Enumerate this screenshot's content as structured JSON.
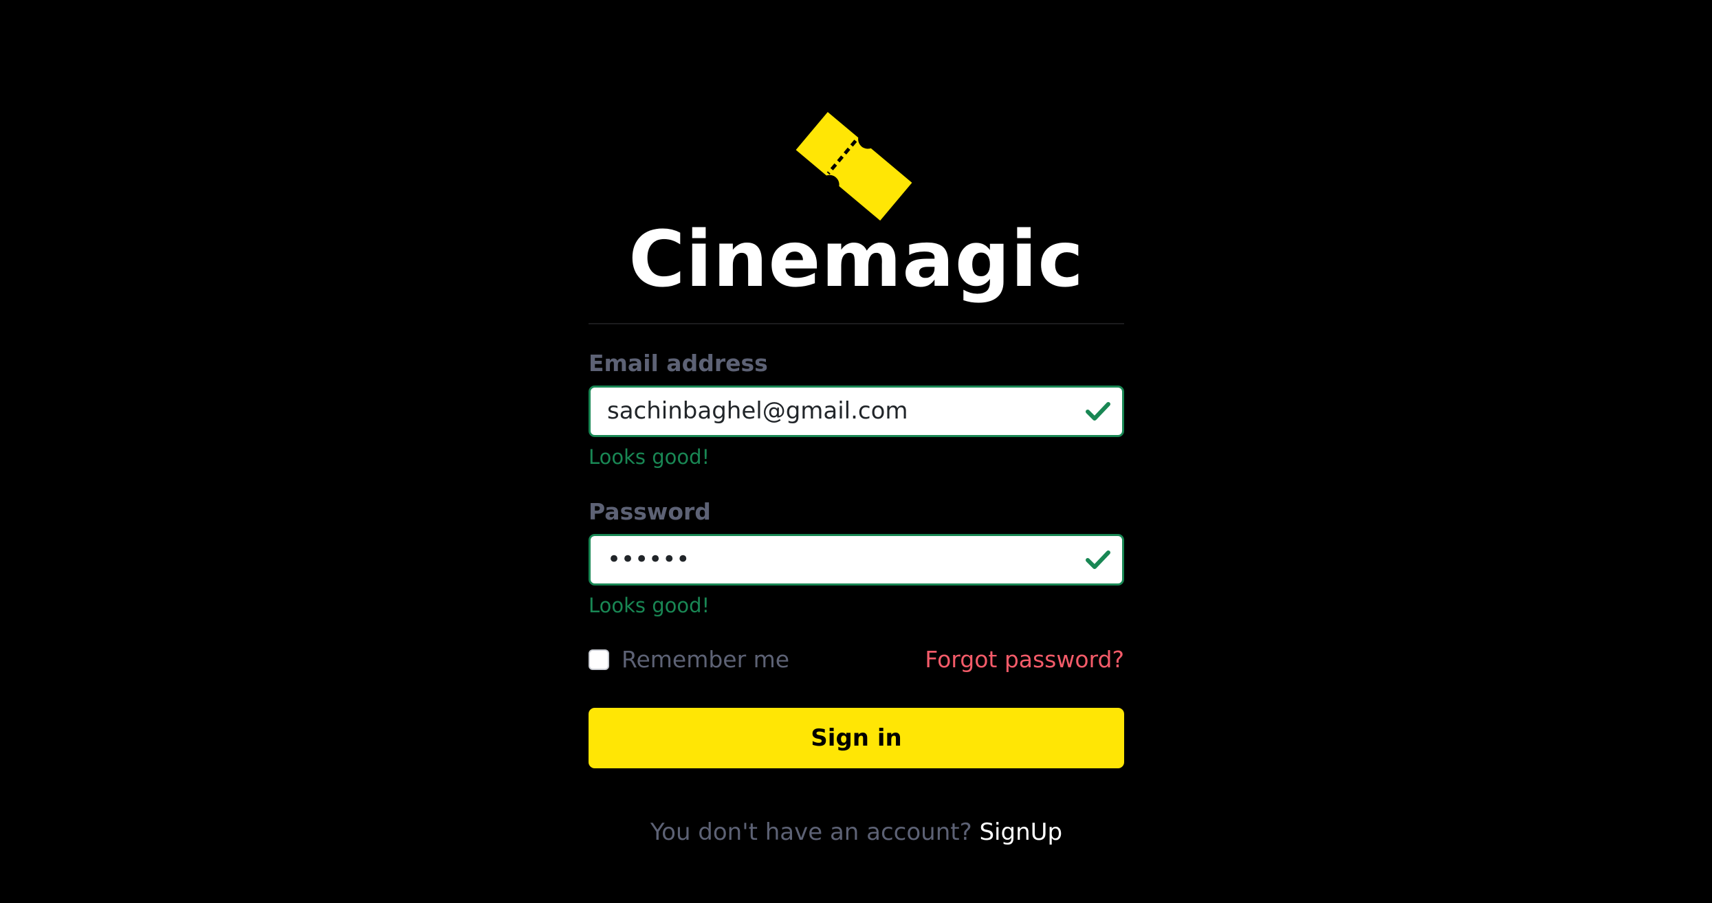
{
  "brand": {
    "logo_icon": "ticket-icon",
    "logo_color": "#ffe605",
    "title": "Cinemagic"
  },
  "form": {
    "email": {
      "label": "Email address",
      "value": "sachinbaghel@gmail.com",
      "feedback": "Looks good!",
      "state_icon": "check-icon"
    },
    "password": {
      "label": "Password",
      "value": "••••••",
      "feedback": "Looks good!",
      "state_icon": "check-icon"
    },
    "remember": {
      "label": "Remember me",
      "checked": false
    },
    "forgot_label": "Forgot password?",
    "submit_label": "Sign in"
  },
  "signup": {
    "prompt": "You don't have an account?",
    "link_label": "SignUp"
  },
  "colors": {
    "background": "#000000",
    "accent": "#ffe605",
    "valid": "#198754",
    "link_danger": "#f45b69",
    "muted_text": "#5d6275"
  }
}
